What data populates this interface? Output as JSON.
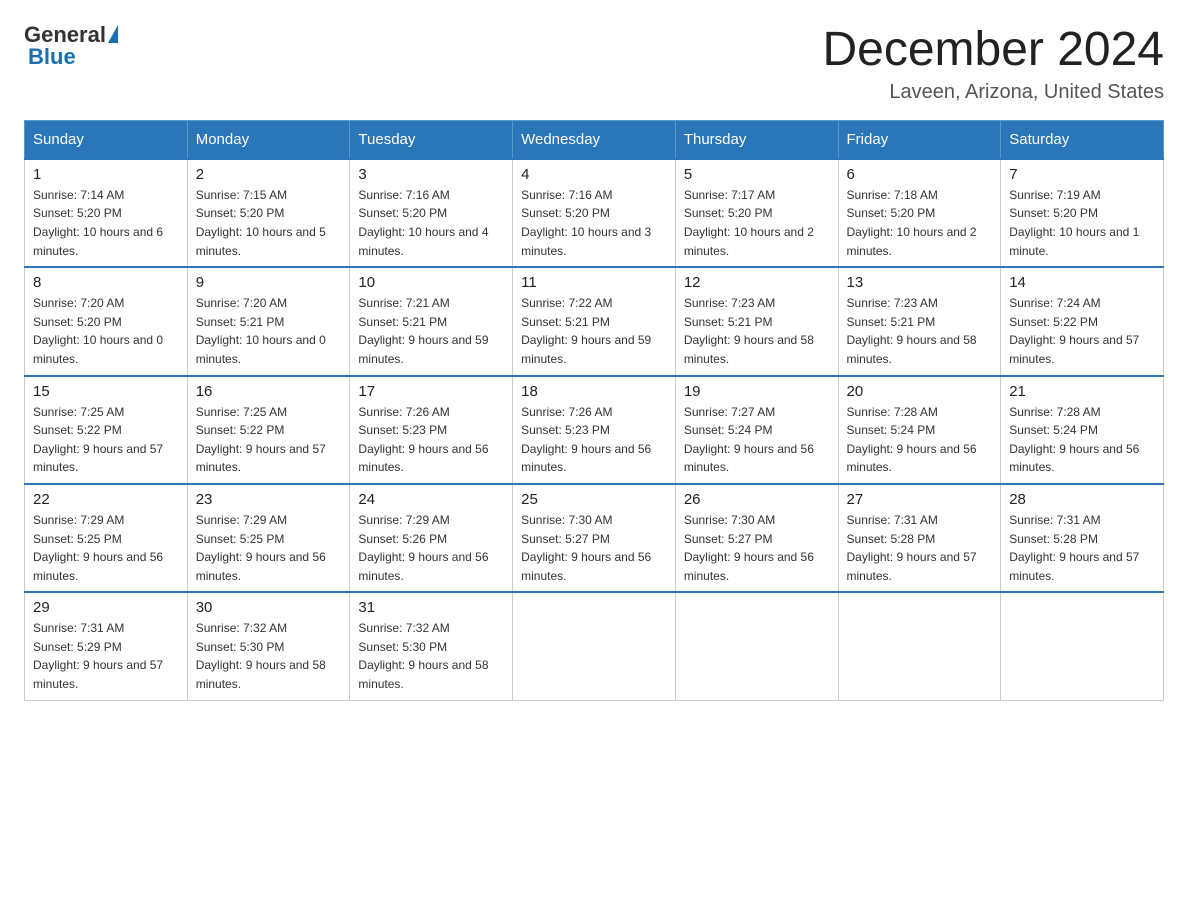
{
  "header": {
    "logo_general": "General",
    "logo_blue": "Blue",
    "month": "December 2024",
    "location": "Laveen, Arizona, United States"
  },
  "days_of_week": [
    "Sunday",
    "Monday",
    "Tuesday",
    "Wednesday",
    "Thursday",
    "Friday",
    "Saturday"
  ],
  "weeks": [
    [
      {
        "day": "1",
        "sunrise": "7:14 AM",
        "sunset": "5:20 PM",
        "daylight": "10 hours and 6 minutes."
      },
      {
        "day": "2",
        "sunrise": "7:15 AM",
        "sunset": "5:20 PM",
        "daylight": "10 hours and 5 minutes."
      },
      {
        "day": "3",
        "sunrise": "7:16 AM",
        "sunset": "5:20 PM",
        "daylight": "10 hours and 4 minutes."
      },
      {
        "day": "4",
        "sunrise": "7:16 AM",
        "sunset": "5:20 PM",
        "daylight": "10 hours and 3 minutes."
      },
      {
        "day": "5",
        "sunrise": "7:17 AM",
        "sunset": "5:20 PM",
        "daylight": "10 hours and 2 minutes."
      },
      {
        "day": "6",
        "sunrise": "7:18 AM",
        "sunset": "5:20 PM",
        "daylight": "10 hours and 2 minutes."
      },
      {
        "day": "7",
        "sunrise": "7:19 AM",
        "sunset": "5:20 PM",
        "daylight": "10 hours and 1 minute."
      }
    ],
    [
      {
        "day": "8",
        "sunrise": "7:20 AM",
        "sunset": "5:20 PM",
        "daylight": "10 hours and 0 minutes."
      },
      {
        "day": "9",
        "sunrise": "7:20 AM",
        "sunset": "5:21 PM",
        "daylight": "10 hours and 0 minutes."
      },
      {
        "day": "10",
        "sunrise": "7:21 AM",
        "sunset": "5:21 PM",
        "daylight": "9 hours and 59 minutes."
      },
      {
        "day": "11",
        "sunrise": "7:22 AM",
        "sunset": "5:21 PM",
        "daylight": "9 hours and 59 minutes."
      },
      {
        "day": "12",
        "sunrise": "7:23 AM",
        "sunset": "5:21 PM",
        "daylight": "9 hours and 58 minutes."
      },
      {
        "day": "13",
        "sunrise": "7:23 AM",
        "sunset": "5:21 PM",
        "daylight": "9 hours and 58 minutes."
      },
      {
        "day": "14",
        "sunrise": "7:24 AM",
        "sunset": "5:22 PM",
        "daylight": "9 hours and 57 minutes."
      }
    ],
    [
      {
        "day": "15",
        "sunrise": "7:25 AM",
        "sunset": "5:22 PM",
        "daylight": "9 hours and 57 minutes."
      },
      {
        "day": "16",
        "sunrise": "7:25 AM",
        "sunset": "5:22 PM",
        "daylight": "9 hours and 57 minutes."
      },
      {
        "day": "17",
        "sunrise": "7:26 AM",
        "sunset": "5:23 PM",
        "daylight": "9 hours and 56 minutes."
      },
      {
        "day": "18",
        "sunrise": "7:26 AM",
        "sunset": "5:23 PM",
        "daylight": "9 hours and 56 minutes."
      },
      {
        "day": "19",
        "sunrise": "7:27 AM",
        "sunset": "5:24 PM",
        "daylight": "9 hours and 56 minutes."
      },
      {
        "day": "20",
        "sunrise": "7:28 AM",
        "sunset": "5:24 PM",
        "daylight": "9 hours and 56 minutes."
      },
      {
        "day": "21",
        "sunrise": "7:28 AM",
        "sunset": "5:24 PM",
        "daylight": "9 hours and 56 minutes."
      }
    ],
    [
      {
        "day": "22",
        "sunrise": "7:29 AM",
        "sunset": "5:25 PM",
        "daylight": "9 hours and 56 minutes."
      },
      {
        "day": "23",
        "sunrise": "7:29 AM",
        "sunset": "5:25 PM",
        "daylight": "9 hours and 56 minutes."
      },
      {
        "day": "24",
        "sunrise": "7:29 AM",
        "sunset": "5:26 PM",
        "daylight": "9 hours and 56 minutes."
      },
      {
        "day": "25",
        "sunrise": "7:30 AM",
        "sunset": "5:27 PM",
        "daylight": "9 hours and 56 minutes."
      },
      {
        "day": "26",
        "sunrise": "7:30 AM",
        "sunset": "5:27 PM",
        "daylight": "9 hours and 56 minutes."
      },
      {
        "day": "27",
        "sunrise": "7:31 AM",
        "sunset": "5:28 PM",
        "daylight": "9 hours and 57 minutes."
      },
      {
        "day": "28",
        "sunrise": "7:31 AM",
        "sunset": "5:28 PM",
        "daylight": "9 hours and 57 minutes."
      }
    ],
    [
      {
        "day": "29",
        "sunrise": "7:31 AM",
        "sunset": "5:29 PM",
        "daylight": "9 hours and 57 minutes."
      },
      {
        "day": "30",
        "sunrise": "7:32 AM",
        "sunset": "5:30 PM",
        "daylight": "9 hours and 58 minutes."
      },
      {
        "day": "31",
        "sunrise": "7:32 AM",
        "sunset": "5:30 PM",
        "daylight": "9 hours and 58 minutes."
      },
      null,
      null,
      null,
      null
    ]
  ]
}
